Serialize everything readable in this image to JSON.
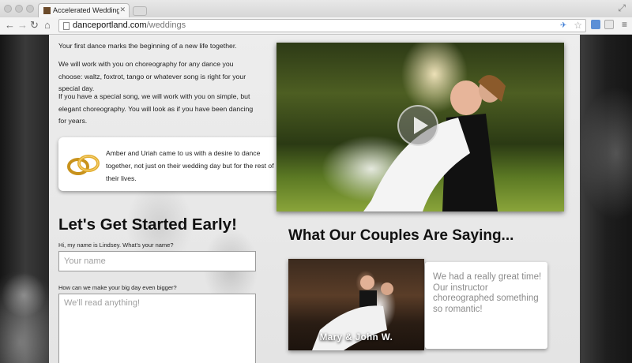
{
  "browser": {
    "tab_title": "Accelerated Wedding Prog",
    "tab_close": "✕",
    "url_host": "danceportland.com",
    "url_path": "/weddings"
  },
  "page": {
    "intro_paragraphs": [
      "Your first dance marks the beginning of a new life together.",
      "We will work with you on choreography for any dance you choose: waltz, foxtrot, tango or whatever song is right for your special day.",
      "If you have a special song, we will work with you on simple, but elegant choreography. You will look as if you have been dancing for years."
    ],
    "testimonial": "Amber and Uriah came to us with a desire to dance together, not just on their wedding day but for the rest of their lives.",
    "form": {
      "heading": "Let's Get Started Early!",
      "name_label": "Hi, my name is Lindsey. What's your name?",
      "name_placeholder": "Your name",
      "message_label": "How can we make your big day even bigger?",
      "message_placeholder": "We'll read anything!"
    },
    "couples": {
      "heading": "What Our Couples Are Saying...",
      "caption": "Mary & John W.",
      "quote": "We had a really great time! Our instructor choreographed something so romantic!"
    }
  },
  "icons": {
    "back": "back-arrow-icon",
    "forward": "forward-arrow-icon",
    "reload": "reload-icon",
    "home": "home-icon",
    "bookmark": "star-icon",
    "menu": "menu-icon",
    "video": "play-icon",
    "rings": "wedding-rings-icon"
  }
}
